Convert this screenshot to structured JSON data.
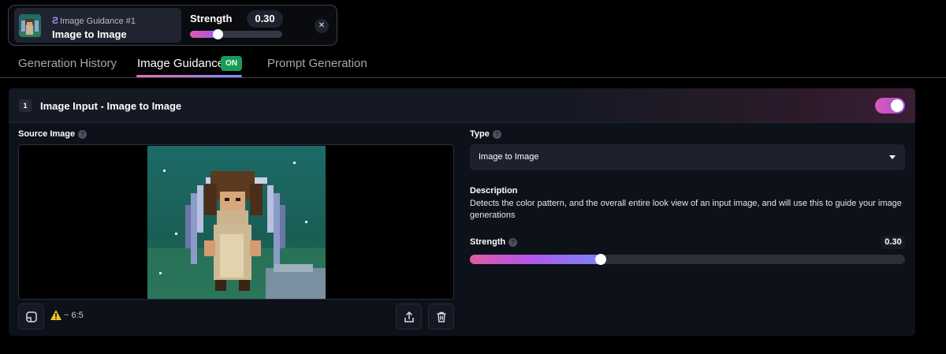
{
  "guidance_chip": {
    "kicker": "Image Guidance #1",
    "title": "Image to Image",
    "strength_label": "Strength",
    "strength_value": "0.30",
    "strength_fraction": 0.3,
    "close_icon": "close-icon"
  },
  "tabs": [
    {
      "label": "Generation History",
      "active": false
    },
    {
      "label": "Image Guidance",
      "active": true,
      "badge": "ON"
    },
    {
      "label": "Prompt Generation",
      "active": false
    }
  ],
  "panel": {
    "step_number": "1",
    "title": "Image Input - Image to Image",
    "enabled": true,
    "source_label": "Source Image",
    "aspect_ratio": "~ 6:5",
    "tools": {
      "crop_icon": "crop-icon",
      "upload_icon": "upload-icon",
      "delete_icon": "trash-icon",
      "warning_icon": "warning-icon"
    },
    "type_label": "Type",
    "type_value": "Image to Image",
    "description_label": "Description",
    "description_text": "Detects the color pattern, and the overall entire look view of an input image, and will use this to guide your image generations",
    "strength_label": "Strength",
    "strength_value": "0.30",
    "strength_fraction": 0.3
  },
  "colors": {
    "accent_pink": "#e05aa3",
    "accent_purple": "#9b59f5",
    "badge_green": "#1b9a57",
    "background": "#000000",
    "panel": "#0d1119"
  }
}
